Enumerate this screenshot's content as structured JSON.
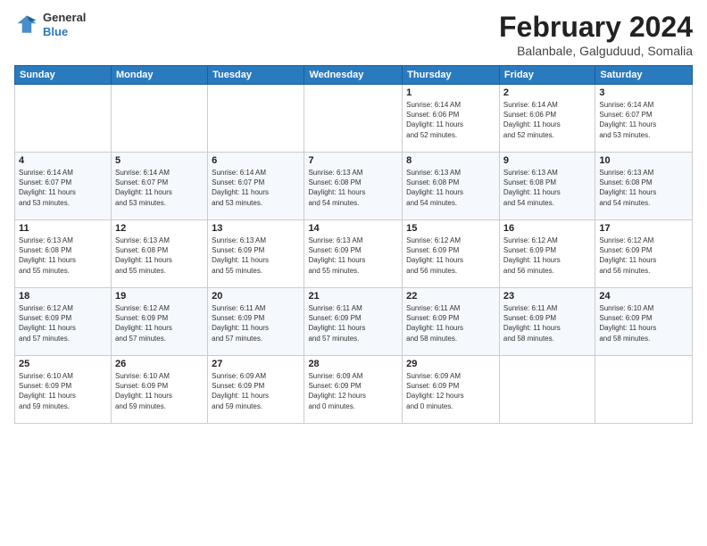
{
  "title": "February 2024",
  "subtitle": "Balanbale, Galguduud, Somalia",
  "logo": {
    "line1": "General",
    "line2": "Blue"
  },
  "days_of_week": [
    "Sunday",
    "Monday",
    "Tuesday",
    "Wednesday",
    "Thursday",
    "Friday",
    "Saturday"
  ],
  "weeks": [
    [
      {
        "day": "",
        "info": ""
      },
      {
        "day": "",
        "info": ""
      },
      {
        "day": "",
        "info": ""
      },
      {
        "day": "",
        "info": ""
      },
      {
        "day": "1",
        "info": "Sunrise: 6:14 AM\nSunset: 6:06 PM\nDaylight: 11 hours\nand 52 minutes."
      },
      {
        "day": "2",
        "info": "Sunrise: 6:14 AM\nSunset: 6:06 PM\nDaylight: 11 hours\nand 52 minutes."
      },
      {
        "day": "3",
        "info": "Sunrise: 6:14 AM\nSunset: 6:07 PM\nDaylight: 11 hours\nand 53 minutes."
      }
    ],
    [
      {
        "day": "4",
        "info": "Sunrise: 6:14 AM\nSunset: 6:07 PM\nDaylight: 11 hours\nand 53 minutes."
      },
      {
        "day": "5",
        "info": "Sunrise: 6:14 AM\nSunset: 6:07 PM\nDaylight: 11 hours\nand 53 minutes."
      },
      {
        "day": "6",
        "info": "Sunrise: 6:14 AM\nSunset: 6:07 PM\nDaylight: 11 hours\nand 53 minutes."
      },
      {
        "day": "7",
        "info": "Sunrise: 6:13 AM\nSunset: 6:08 PM\nDaylight: 11 hours\nand 54 minutes."
      },
      {
        "day": "8",
        "info": "Sunrise: 6:13 AM\nSunset: 6:08 PM\nDaylight: 11 hours\nand 54 minutes."
      },
      {
        "day": "9",
        "info": "Sunrise: 6:13 AM\nSunset: 6:08 PM\nDaylight: 11 hours\nand 54 minutes."
      },
      {
        "day": "10",
        "info": "Sunrise: 6:13 AM\nSunset: 6:08 PM\nDaylight: 11 hours\nand 54 minutes."
      }
    ],
    [
      {
        "day": "11",
        "info": "Sunrise: 6:13 AM\nSunset: 6:08 PM\nDaylight: 11 hours\nand 55 minutes."
      },
      {
        "day": "12",
        "info": "Sunrise: 6:13 AM\nSunset: 6:08 PM\nDaylight: 11 hours\nand 55 minutes."
      },
      {
        "day": "13",
        "info": "Sunrise: 6:13 AM\nSunset: 6:09 PM\nDaylight: 11 hours\nand 55 minutes."
      },
      {
        "day": "14",
        "info": "Sunrise: 6:13 AM\nSunset: 6:09 PM\nDaylight: 11 hours\nand 55 minutes."
      },
      {
        "day": "15",
        "info": "Sunrise: 6:12 AM\nSunset: 6:09 PM\nDaylight: 11 hours\nand 56 minutes."
      },
      {
        "day": "16",
        "info": "Sunrise: 6:12 AM\nSunset: 6:09 PM\nDaylight: 11 hours\nand 56 minutes."
      },
      {
        "day": "17",
        "info": "Sunrise: 6:12 AM\nSunset: 6:09 PM\nDaylight: 11 hours\nand 56 minutes."
      }
    ],
    [
      {
        "day": "18",
        "info": "Sunrise: 6:12 AM\nSunset: 6:09 PM\nDaylight: 11 hours\nand 57 minutes."
      },
      {
        "day": "19",
        "info": "Sunrise: 6:12 AM\nSunset: 6:09 PM\nDaylight: 11 hours\nand 57 minutes."
      },
      {
        "day": "20",
        "info": "Sunrise: 6:11 AM\nSunset: 6:09 PM\nDaylight: 11 hours\nand 57 minutes."
      },
      {
        "day": "21",
        "info": "Sunrise: 6:11 AM\nSunset: 6:09 PM\nDaylight: 11 hours\nand 57 minutes."
      },
      {
        "day": "22",
        "info": "Sunrise: 6:11 AM\nSunset: 6:09 PM\nDaylight: 11 hours\nand 58 minutes."
      },
      {
        "day": "23",
        "info": "Sunrise: 6:11 AM\nSunset: 6:09 PM\nDaylight: 11 hours\nand 58 minutes."
      },
      {
        "day": "24",
        "info": "Sunrise: 6:10 AM\nSunset: 6:09 PM\nDaylight: 11 hours\nand 58 minutes."
      }
    ],
    [
      {
        "day": "25",
        "info": "Sunrise: 6:10 AM\nSunset: 6:09 PM\nDaylight: 11 hours\nand 59 minutes."
      },
      {
        "day": "26",
        "info": "Sunrise: 6:10 AM\nSunset: 6:09 PM\nDaylight: 11 hours\nand 59 minutes."
      },
      {
        "day": "27",
        "info": "Sunrise: 6:09 AM\nSunset: 6:09 PM\nDaylight: 11 hours\nand 59 minutes."
      },
      {
        "day": "28",
        "info": "Sunrise: 6:09 AM\nSunset: 6:09 PM\nDaylight: 12 hours\nand 0 minutes."
      },
      {
        "day": "29",
        "info": "Sunrise: 6:09 AM\nSunset: 6:09 PM\nDaylight: 12 hours\nand 0 minutes."
      },
      {
        "day": "",
        "info": ""
      },
      {
        "day": "",
        "info": ""
      }
    ]
  ]
}
